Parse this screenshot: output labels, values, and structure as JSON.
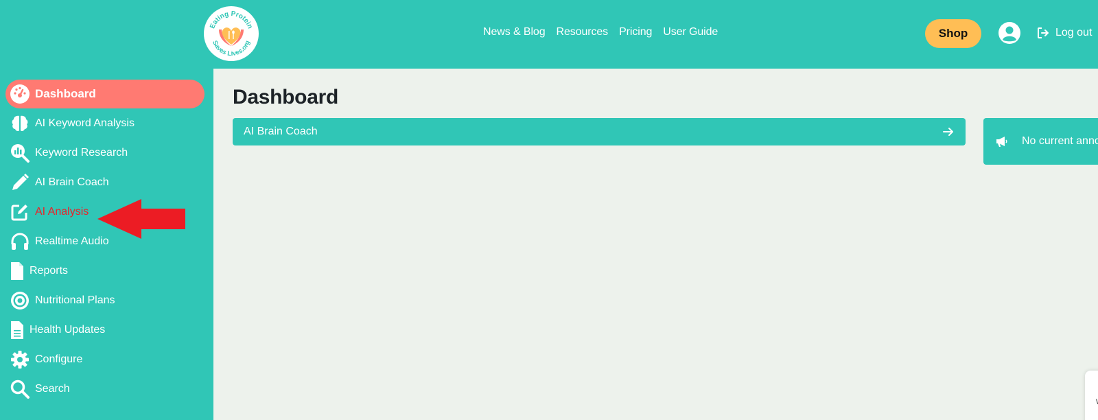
{
  "header": {
    "logo": {
      "text_top": "Eating Protein",
      "text_bottom": "Saves Lives.org",
      "icon": "hands-heart-fork-spoon-icon"
    },
    "nav": [
      "News & Blog",
      "Resources",
      "Pricing",
      "User Guide"
    ],
    "shop_label": "Shop",
    "user_icon": "user-circle-icon",
    "logout_label": "Log out"
  },
  "sidebar": {
    "items": [
      {
        "label": "Dashboard",
        "icon": "gauge-icon",
        "active": true
      },
      {
        "label": "AI Keyword Analysis",
        "icon": "brain-icon"
      },
      {
        "label": "Keyword Research",
        "icon": "chart-magnifier-icon"
      },
      {
        "label": "AI Brain Coach",
        "icon": "pencil-icon"
      },
      {
        "label": "AI Analysis",
        "icon": "edit-icon",
        "highlighted": true
      },
      {
        "label": "Realtime Audio",
        "icon": "headphones-icon"
      },
      {
        "label": "Reports",
        "icon": "file-icon"
      },
      {
        "label": "Nutritional Plans",
        "icon": "target-icon"
      },
      {
        "label": "Health Updates",
        "icon": "file-lines-icon"
      },
      {
        "label": "Configure",
        "icon": "gear-icon"
      },
      {
        "label": "Search",
        "icon": "search-icon"
      }
    ]
  },
  "main": {
    "title": "Dashboard",
    "coach_bar_label": "AI Brain Coach",
    "announcement": "No current announcements"
  },
  "colors": {
    "brand_teal": "#30c6b6",
    "active_coral": "#ff7a72",
    "shop_yellow": "#ffbe55",
    "arrow_red": "#ec1c24",
    "content_bg": "#edf2ec"
  },
  "corner_widget_letter": "W"
}
